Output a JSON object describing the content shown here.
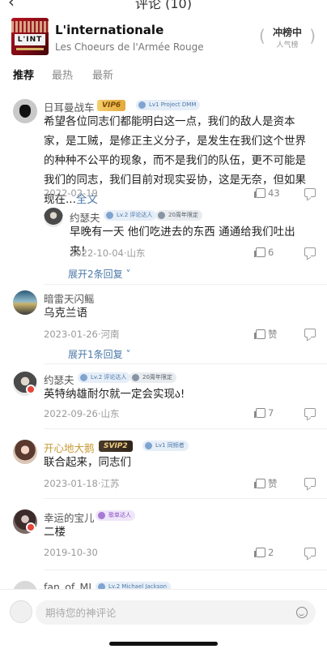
{
  "header": {
    "back_icon": "chevron-left-icon",
    "title": "评论 (10)"
  },
  "song": {
    "cover_text": "L'INT",
    "title": "L'internationale",
    "artist": "Les Choeurs de l'Armée Rouge",
    "rank_label": "冲榜中",
    "rank_sub": "人气榜"
  },
  "tabs": [
    {
      "label": "推荐",
      "active": true
    },
    {
      "label": "最热",
      "active": false
    },
    {
      "label": "最新",
      "active": false
    }
  ],
  "comments": [
    {
      "user": "日耳曼战车",
      "vip": "VIP6",
      "tags": [
        "Lv1 Project DMM"
      ],
      "text": "希望各位同志们都能明白这一点，我们的敌人是资本家，是工贼，是修正主义分子，是发生在我们这个世界的种种不公平的现象，而不是我们的队伍，更不可能是我们的同志，我们目前对现实妥协，这是无奈，但如果现在...",
      "more": "全文",
      "date": "2022-02-19",
      "likes": "43",
      "reply": {
        "user": "约瑟夫",
        "tags": [
          "Lv.2 评论达人",
          "20周年限定"
        ],
        "text": "早晚有一天 他们吃进去的东西 通通给我们吐出来！",
        "date": "2022-10-04",
        "location": "山东",
        "likes": "6"
      },
      "expand": "展开2条回复"
    },
    {
      "user": "暗雷天闪鳐",
      "text": "乌克兰语",
      "date": "2023-01-26",
      "location": "河南",
      "likes": "赞",
      "expand": "展开1条回复"
    },
    {
      "user": "约瑟夫",
      "tags": [
        "Lv.2 评论达人",
        "20周年限定"
      ],
      "text": "英特纳雄耐尔就一定会实现ა!",
      "date": "2022-09-26",
      "location": "山东",
      "likes": "7"
    },
    {
      "user": "开心地大鹅",
      "vip": "SVIP2",
      "tags": [
        "Lv1 同频者"
      ],
      "text": "联合起来，同志们",
      "date": "2023-01-18",
      "location": "江苏",
      "likes": "赞"
    },
    {
      "user": "幸运的宝儿",
      "tags": [
        "歌单达人"
      ],
      "text": "二楼",
      "date": "2019-10-30",
      "likes": "2"
    },
    {
      "user": "fan_of_MJ",
      "tags": [
        "Lv.2 Michael Jackson"
      ]
    }
  ],
  "bottom": {
    "placeholder": "期待您的神评论",
    "emoji_icon": "smile-icon"
  },
  "colors": {
    "link": "#4a78a8",
    "vip_gold": "#e4a83a",
    "badge_red": "#e8443a"
  }
}
